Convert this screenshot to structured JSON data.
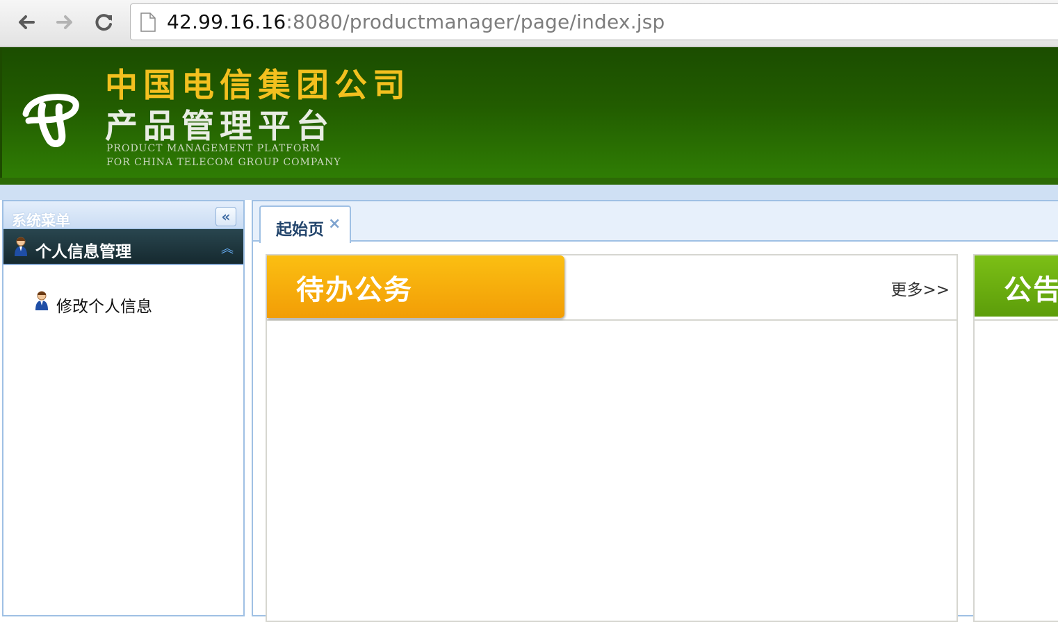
{
  "browser": {
    "back_icon": "arrow-left-icon",
    "forward_icon": "arrow-right-icon",
    "reload_icon": "reload-icon",
    "url_host": "42.99.16.16",
    "url_path": ":8080/productmanager/page/index.jsp"
  },
  "banner": {
    "title_line1": "中国电信集团公司",
    "title_line2": "产品管理平台",
    "english_line1": "PRODUCT MANAGEMENT PLATFORM",
    "english_line2": "FOR CHINA TELECOM GROUP COMPANY"
  },
  "sidebar": {
    "title": "系统菜单",
    "collapse_label": "«",
    "section": {
      "title": "个人信息管理",
      "toggle": "︽",
      "items": [
        {
          "label": "修改个人信息",
          "icon": "user-icon"
        }
      ]
    }
  },
  "main": {
    "tabs": [
      {
        "label": "起始页",
        "close": "×"
      }
    ],
    "panels": [
      {
        "title": "待办公务",
        "more": "更多>>"
      },
      {
        "title": "公告"
      }
    ]
  },
  "colors": {
    "banner_green": "#225c00",
    "title_gold": "#f3c01f",
    "panel_orange": "#f7ad0a",
    "panel_green": "#6cad10",
    "frame_blue": "#9fc0e4"
  }
}
